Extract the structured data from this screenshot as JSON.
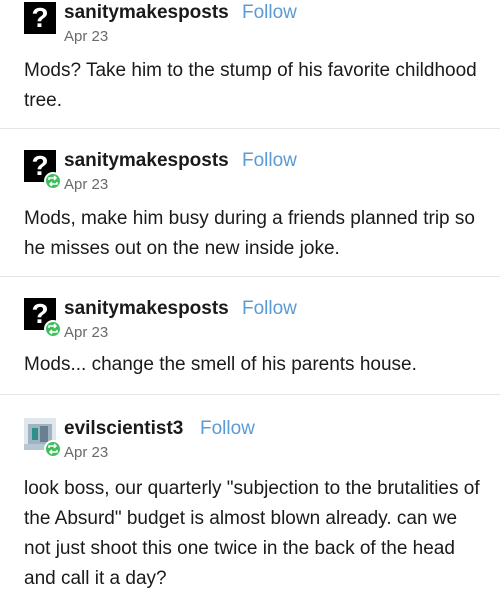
{
  "posts": [
    {
      "username": "sanitymakesposts",
      "follow_label": "Follow",
      "date": "Apr 23",
      "avatar_glyph": "?",
      "reblogged": false,
      "body": "Mods? Take him to the stump of his favorite childhood tree."
    },
    {
      "username": "sanitymakesposts",
      "follow_label": "Follow",
      "date": "Apr 23",
      "avatar_glyph": "?",
      "reblogged": true,
      "body": "Mods, make him busy during a friends planned trip so he misses out on the new inside joke."
    },
    {
      "username": "sanitymakesposts",
      "follow_label": "Follow",
      "date": "Apr 23",
      "avatar_glyph": "?",
      "reblogged": true,
      "body": "Mods... change the smell of his parents house."
    },
    {
      "username": "evilscientist3",
      "follow_label": "Follow",
      "date": "Apr 23",
      "avatar_glyph": "",
      "reblogged": true,
      "body": "look boss, our quarterly \"subjection to the brutalities of the Absurd\" budget is almost blown already. can we not just shoot this one twice in the back of the head and call it a day?"
    }
  ],
  "colors": {
    "follow": "#5b9bd5",
    "reblog_badge": "#3fbf5c",
    "date": "#6a6a6a",
    "divider": "#e5e5e5"
  },
  "icons": {
    "reblog_badge": "reblog-icon",
    "avatar_default": "question-mark-avatar"
  }
}
